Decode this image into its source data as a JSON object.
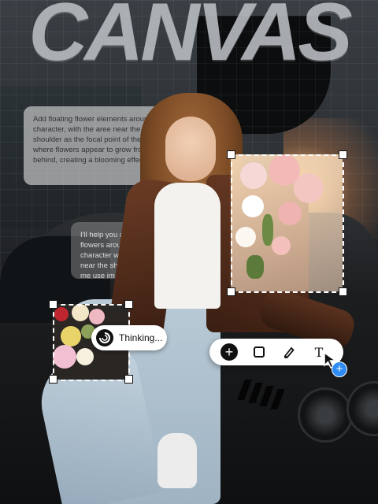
{
  "poster": {
    "title": "CANVAS"
  },
  "chat": {
    "bubble_1": "Add floating flower elements around the character, with the aree near the shoulder as the focal point of the image, where flowers appear to grow from behind, creating a blooming effect.",
    "bubble_2": "I'll help you add floating flowers around the character with a focus near the shoulders. Let me use image editing abilities to enhance your image."
  },
  "status": {
    "thinking_label": "Thinking..."
  },
  "toolbar": {
    "tools": [
      "add-icon",
      "rectangle-icon",
      "pen-icon",
      "text-icon"
    ],
    "text_tool_glyph": "T"
  },
  "colors": {
    "cursor_badge": "#2f8cf4",
    "toolbar_bg": "#ffffff",
    "selection_stroke": "#ffffff"
  }
}
